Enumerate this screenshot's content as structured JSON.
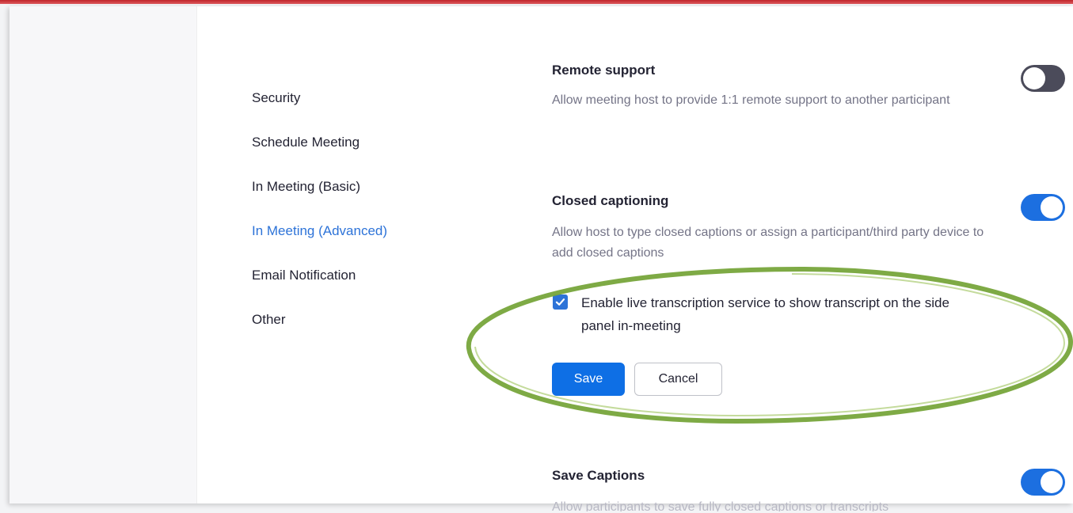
{
  "nav": {
    "items": [
      {
        "label": "Security",
        "active": false
      },
      {
        "label": "Schedule Meeting",
        "active": false
      },
      {
        "label": "In Meeting (Basic)",
        "active": false
      },
      {
        "label": "In Meeting (Advanced)",
        "active": true
      },
      {
        "label": "Email Notification",
        "active": false
      },
      {
        "label": "Other",
        "active": false
      }
    ]
  },
  "settings": {
    "remote_support": {
      "title": "Remote support",
      "description": "Allow meeting host to provide 1:1 remote support to another participant",
      "enabled": false
    },
    "closed_captioning": {
      "title": "Closed captioning",
      "description": "Allow host to type closed captions or assign a participant/third party device to add closed captions",
      "enabled": true,
      "live_transcription": {
        "label": "Enable live transcription service to show transcript on the side panel in-meeting",
        "checked": true
      },
      "save_label": "Save",
      "cancel_label": "Cancel"
    },
    "save_captions": {
      "title": "Save Captions",
      "description": "Allow participants to save fully closed captions or transcripts",
      "enabled": true
    }
  },
  "colors": {
    "accent": "#0e6fe5",
    "active_nav": "#2d73d8",
    "toggle_off": "#4b4b5a",
    "highlight_ellipse": "#77a53b",
    "top_bar": "#c0252b"
  },
  "icons": {
    "checkbox": "checkmark-icon"
  }
}
